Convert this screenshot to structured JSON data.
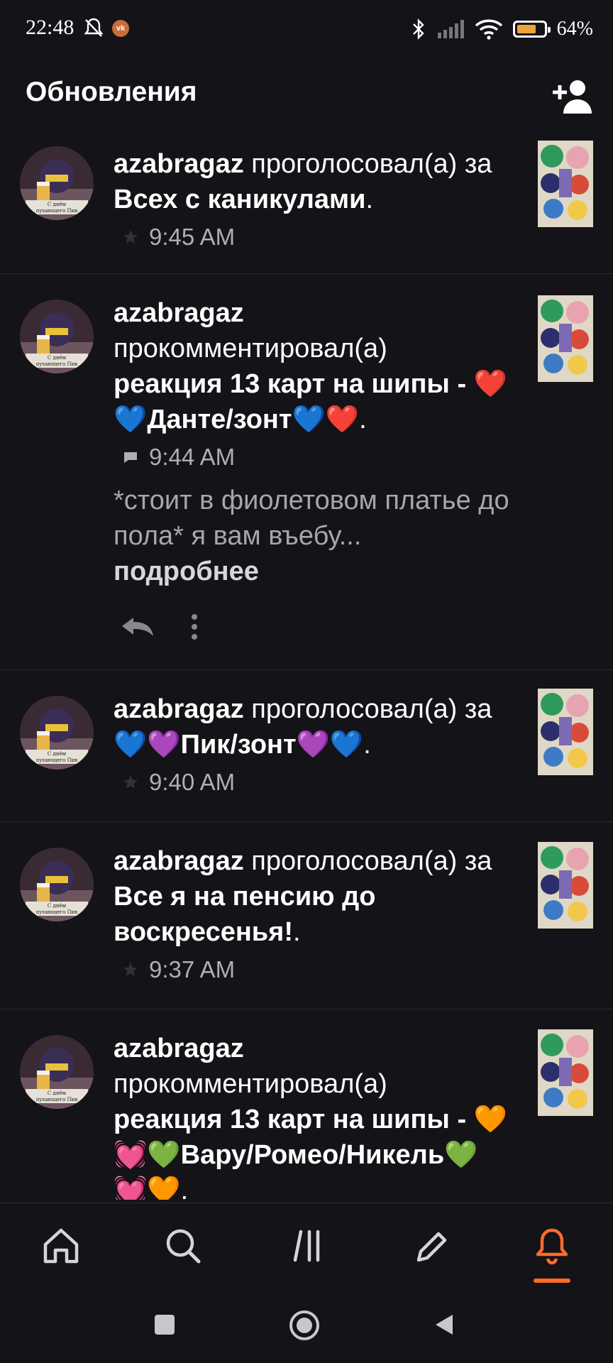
{
  "status_bar": {
    "time": "22:48",
    "vk_badge": "vk",
    "battery_text": "64%",
    "battery_level": 0.64,
    "icons": [
      "bell-off-icon",
      "vk-icon",
      "bluetooth-icon",
      "signal-icon",
      "wifi-icon",
      "battery-icon"
    ]
  },
  "header": {
    "title": "Обновления",
    "add_user_icon": "add-user-icon"
  },
  "feed": [
    {
      "user": "azabragaz",
      "action": " проголосовал(а) за ",
      "post": "Всех с каникулами",
      "end": ".",
      "meta_icon": "star-icon",
      "time": "9:45 AM"
    },
    {
      "user": "azabragaz",
      "action": " прокомментировал(а) ",
      "post": "реакция 13 карт на шипы - ❤️💙Данте/зонт💙❤️",
      "end": ".",
      "meta_icon": "comment-icon",
      "time": "9:44 AM",
      "excerpt": "*стоит в фиолетовом платье до пола*  я вам въебу...",
      "more": " подробнее"
    },
    {
      "user": "azabragaz",
      "action": " проголосовал(а) за ",
      "post": "💙💜Пик/зонт💜💙",
      "end": ".",
      "meta_icon": "star-icon",
      "time": "9:40 AM"
    },
    {
      "user": "azabragaz",
      "action": " проголосовал(а) за ",
      "post": "Все я на пенсию до воскресенья!",
      "end": ".",
      "meta_icon": "star-icon",
      "time": "9:37 AM"
    },
    {
      "user": "azabragaz",
      "action": " прокомментировал(а) ",
      "post": "реакция 13 карт на шипы - 🧡💓💚Вару/Ромео/Никель💚💓🧡",
      "end": "."
    }
  ],
  "avatar_caption": "С днём пухающего Пив",
  "bottom_nav": [
    "home-icon",
    "search-icon",
    "library-icon",
    "write-icon",
    "notifications-icon"
  ],
  "accent_color": "#ff6b2a",
  "system_nav": [
    "recents-button",
    "home-button",
    "back-button"
  ]
}
